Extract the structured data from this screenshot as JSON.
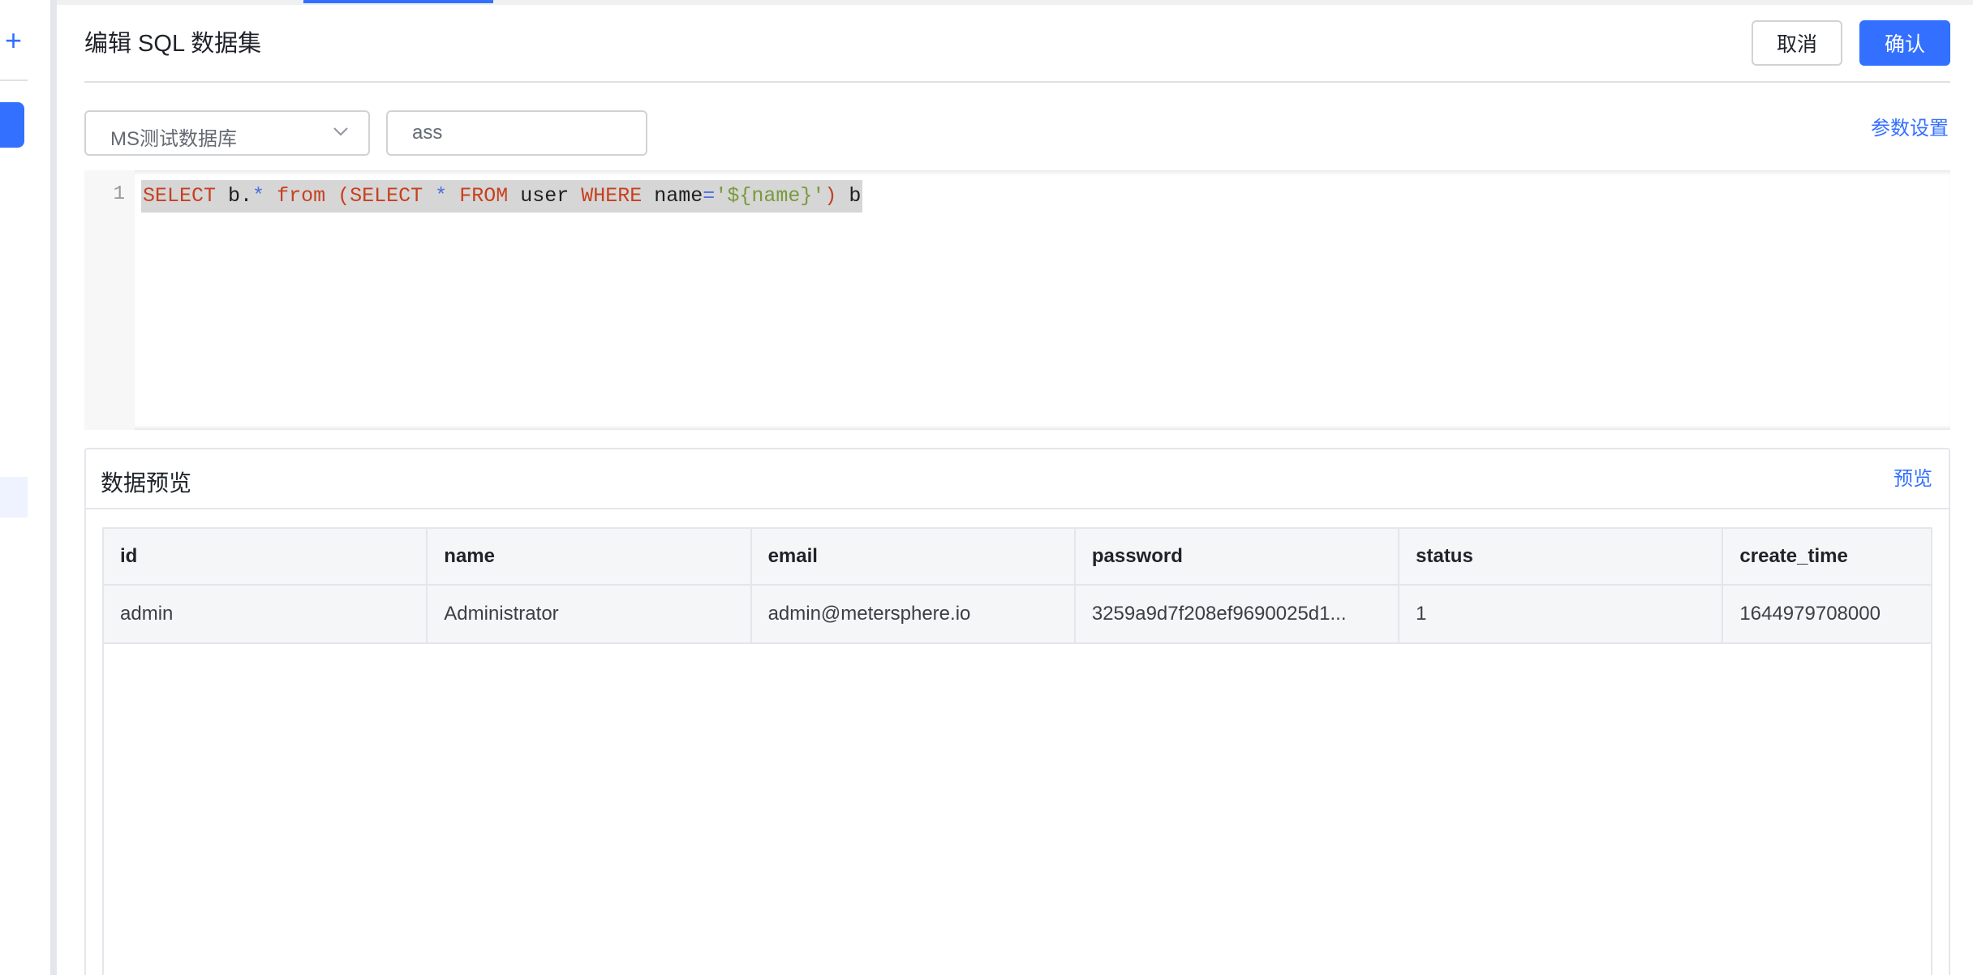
{
  "header": {
    "title": "编辑 SQL 数据集",
    "cancel_label": "取消",
    "confirm_label": "确认"
  },
  "form": {
    "datasource": "MS测试数据库",
    "name_value": "ass",
    "param_settings_label": "参数设置"
  },
  "editor": {
    "line_number": "1",
    "sql": "SELECT b.* from (SELECT * FROM user WHERE name='${name}') b"
  },
  "preview": {
    "title": "数据预览",
    "preview_label": "预览",
    "columns": [
      "id",
      "name",
      "email",
      "password",
      "status",
      "create_time"
    ],
    "rows": [
      [
        "admin",
        "Administrator",
        "admin@metersphere.io",
        "3259a9d7f208ef9690025d1...",
        "1",
        "1644979708000"
      ]
    ]
  },
  "colors": {
    "primary": "#3370ff",
    "border": "#e4e6eb"
  }
}
